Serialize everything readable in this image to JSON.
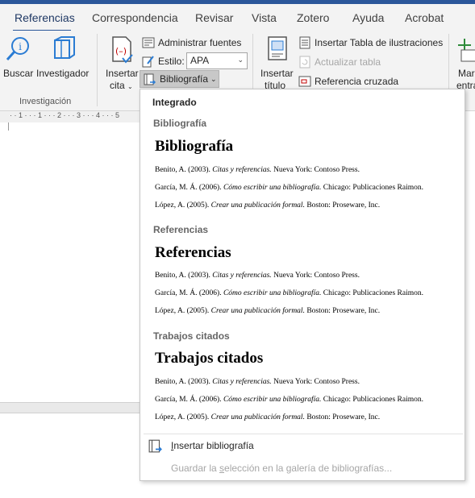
{
  "tabs": [
    {
      "label": "Referencias",
      "active": true
    },
    {
      "label": "Correspondencia"
    },
    {
      "label": "Revisar"
    },
    {
      "label": "Vista"
    },
    {
      "label": "Zotero"
    },
    {
      "label": "Ayuda"
    },
    {
      "label": "Acrobat"
    }
  ],
  "ribbon": {
    "buscar": "Buscar",
    "investigador": "Investigador",
    "investigacion_group": "Investigación",
    "insertar_cita_1": "Insertar",
    "insertar_cita_2": "cita",
    "administrar_fuentes": "Administrar fuentes",
    "estilo_label": "Estilo:",
    "estilo_value": "APA",
    "bibliografia": "Bibliografía",
    "insertar_titulo_1": "Insertar",
    "insertar_titulo_2": "título",
    "insertar_tabla": "Insertar Tabla de ilustraciones",
    "actualizar_tabla": "Actualizar tabla",
    "referencia_cruzada": "Referencia cruzada",
    "marcar_entrada_1": "Mar",
    "marcar_entrada_2": "entra"
  },
  "ruler": {
    "ticks": "· · 1 · · · 1 · · · 2 · · · 3 · · · 4 · · · 5"
  },
  "dropdown": {
    "header": "Integrado",
    "items": [
      {
        "subheader": "Bibliografía",
        "heading": "Bibliografía",
        "refs": [
          {
            "a": "Benito, A. (2003). ",
            "t": "Citas y referencias.",
            "b": " Nueva York: Contoso Press."
          },
          {
            "a": "García, M. Á. (2006). ",
            "t": "Cómo escribir una bibliografía.",
            "b": " Chicago: Publicaciones Raimon."
          },
          {
            "a": "López, A. (2005). ",
            "t": "Crear una publicación formal.",
            "b": " Boston: Proseware, Inc."
          }
        ]
      },
      {
        "subheader": "Referencias",
        "heading": "Referencias",
        "refs": [
          {
            "a": "Benito, A. (2003). ",
            "t": "Citas y referencias.",
            "b": " Nueva York: Contoso Press."
          },
          {
            "a": "García, M. Á. (2006). ",
            "t": "Cómo escribir una bibliografía.",
            "b": " Chicago: Publicaciones Raimon."
          },
          {
            "a": "López, A. (2005). ",
            "t": "Crear una publicación formal.",
            "b": " Boston: Proseware, Inc."
          }
        ]
      },
      {
        "subheader": "Trabajos citados",
        "heading": "Trabajos citados",
        "refs": [
          {
            "a": "Benito, A. (2003). ",
            "t": "Citas y referencias.",
            "b": " Nueva York: Contoso Press."
          },
          {
            "a": "García, M. Á. (2006). ",
            "t": "Cómo escribir una bibliografía.",
            "b": " Chicago: Publicaciones Raimon."
          },
          {
            "a": "López, A. (2005). ",
            "t": "Crear una publicación formal.",
            "b": " Boston: Proseware, Inc."
          }
        ]
      }
    ],
    "insert_action_pre": "I",
    "insert_action_rest": "nsertar bibliografía",
    "save_action_pre": "Guardar la ",
    "save_action_u": "s",
    "save_action_rest": "elección en la galería de bibliografías..."
  },
  "colors": {
    "accent": "#2b579a",
    "ribbon_bg": "#f3f3f3"
  }
}
